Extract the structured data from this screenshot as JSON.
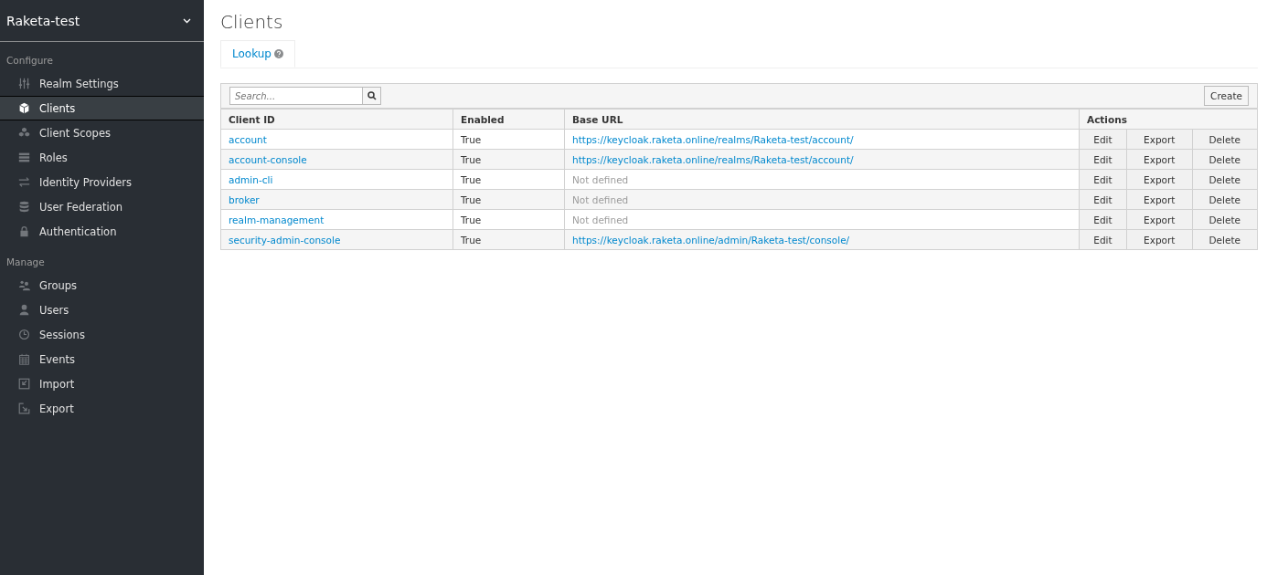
{
  "realm_selector": {
    "label": "Raketa-test"
  },
  "sidebar": {
    "sections": [
      {
        "title": "Configure",
        "items": [
          {
            "label": "Realm Settings",
            "kind": "sliders",
            "selected": false
          },
          {
            "label": "Clients",
            "kind": "cube",
            "selected": true
          },
          {
            "label": "Client Scopes",
            "kind": "cubes",
            "selected": false
          },
          {
            "label": "Roles",
            "kind": "list",
            "selected": false
          },
          {
            "label": "Identity Providers",
            "kind": "exchange",
            "selected": false
          },
          {
            "label": "User Federation",
            "kind": "database",
            "selected": false
          },
          {
            "label": "Authentication",
            "kind": "lock",
            "selected": false
          }
        ]
      },
      {
        "title": "Manage",
        "items": [
          {
            "label": "Groups",
            "kind": "users",
            "selected": false
          },
          {
            "label": "Users",
            "kind": "user",
            "selected": false
          },
          {
            "label": "Sessions",
            "kind": "clock",
            "selected": false
          },
          {
            "label": "Events",
            "kind": "calendar",
            "selected": false
          },
          {
            "label": "Import",
            "kind": "import",
            "selected": false
          },
          {
            "label": "Export",
            "kind": "export",
            "selected": false
          }
        ]
      }
    ]
  },
  "page": {
    "title": "Clients",
    "tabs": [
      {
        "label": "Lookup",
        "selected": true
      }
    ]
  },
  "toolbar": {
    "search": {
      "placeholder": "Search..."
    },
    "create_button": "Create"
  },
  "table": {
    "columns": [
      "Client ID",
      "Enabled",
      "Base URL",
      "Actions"
    ],
    "rows": [
      {
        "client_id": "account",
        "enabled": "True",
        "base_url": {
          "kind": "link",
          "text": "https://keycloak.raketa.online/realms/Raketa-test/account/"
        },
        "actions": [
          "Edit",
          "Export",
          "Delete"
        ]
      },
      {
        "client_id": "account-console",
        "enabled": "True",
        "base_url": {
          "kind": "link",
          "text": "https://keycloak.raketa.online/realms/Raketa-test/account/"
        },
        "actions": [
          "Edit",
          "Export",
          "Delete"
        ]
      },
      {
        "client_id": "admin-cli",
        "enabled": "True",
        "base_url": {
          "kind": "none",
          "text": "Not defined"
        },
        "actions": [
          "Edit",
          "Export",
          "Delete"
        ]
      },
      {
        "client_id": "broker",
        "enabled": "True",
        "base_url": {
          "kind": "none",
          "text": "Not defined"
        },
        "actions": [
          "Edit",
          "Export",
          "Delete"
        ]
      },
      {
        "client_id": "realm-management",
        "enabled": "True",
        "base_url": {
          "kind": "none",
          "text": "Not defined"
        },
        "actions": [
          "Edit",
          "Export",
          "Delete"
        ]
      },
      {
        "client_id": "security-admin-console",
        "enabled": "True",
        "base_url": {
          "kind": "link",
          "text": "https://keycloak.raketa.online/admin/Raketa-test/console/"
        },
        "actions": [
          "Edit",
          "Export",
          "Delete"
        ]
      }
    ]
  }
}
